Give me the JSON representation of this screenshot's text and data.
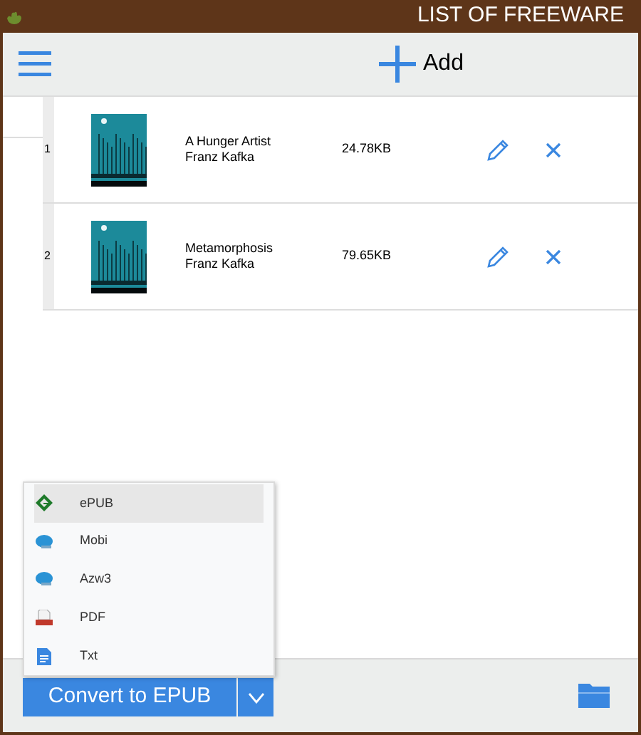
{
  "window": {
    "title": "LIST OF FREEWARE"
  },
  "toolbar": {
    "add_label": "Add"
  },
  "books": [
    {
      "number": "1",
      "title": "A Hunger Artist",
      "author": "Franz Kafka",
      "size": "24.78KB"
    },
    {
      "number": "2",
      "title": "Metamorphosis",
      "author": "Franz Kafka",
      "size": "79.65KB"
    }
  ],
  "format_menu": {
    "items": [
      {
        "label": "ePUB",
        "kind": "epub",
        "selected": true
      },
      {
        "label": "Mobi",
        "kind": "book",
        "selected": false
      },
      {
        "label": "Azw3",
        "kind": "book",
        "selected": false
      },
      {
        "label": "PDF",
        "kind": "pdf",
        "selected": false
      },
      {
        "label": "Txt",
        "kind": "txt",
        "selected": false
      }
    ]
  },
  "convert_button": {
    "label": "Convert to EPUB"
  }
}
